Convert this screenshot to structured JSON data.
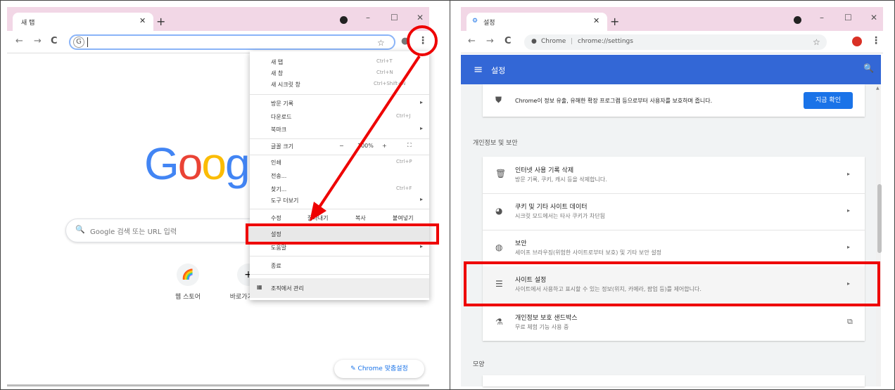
{
  "left": {
    "tab_title": "새 탭",
    "search_placeholder": "Google 검색 또는 URL 입력",
    "shortcuts": [
      "웹 스토어",
      "바로가기 추가"
    ],
    "customize_label": "Chrome 맞춤설정",
    "menu": {
      "new_tab": "새 탭",
      "new_tab_shortcut": "Ctrl+T",
      "new_window": "새 창",
      "new_window_shortcut": "Ctrl+N",
      "incognito": "새 시크릿 창",
      "incognito_shortcut": "Ctrl+Shift+N",
      "history": "방문 기록",
      "downloads": "다운로드",
      "downloads_shortcut": "Ctrl+J",
      "bookmarks": "북마크",
      "zoom": "글꼴 크기",
      "zoom_value": "100%",
      "print": "인쇄",
      "print_shortcut": "Ctrl+P",
      "cast": "전송...",
      "find": "찾기...",
      "find_shortcut": "Ctrl+F",
      "more_tools": "도구 더보기",
      "edit": "수정",
      "cut": "잘라내기",
      "copy": "복사",
      "paste": "붙여넣기",
      "settings": "설정",
      "help": "도움말",
      "exit": "종료",
      "managed": "조직에서 관리"
    }
  },
  "right": {
    "tab_title": "설정",
    "url_prefix": "Chrome",
    "url": "chrome://settings",
    "header_title": "설정",
    "safety_text": "Chrome이 정보 유출, 유해한 확장 프로그램 등으로부터 사용자를 보호하며 줍니다.",
    "safety_button": "지금 확인",
    "privacy_section": "개인정보 및 보안",
    "rows": [
      {
        "title": "인터넷 사용 기록 삭제",
        "sub": "방문 기록, 쿠키, 캐시 등을 삭제합니다."
      },
      {
        "title": "쿠키 및 기타 사이트 데이터",
        "sub": "시크릿 모드에서는 타사 쿠키가 차단됨"
      },
      {
        "title": "보안",
        "sub": "세이프 브라우징(위험한 사이트로부터 보호) 및 기타 보안 설정"
      },
      {
        "title": "사이트 설정",
        "sub": "사이트에서 사용하고 표시할 수 있는 정보(위치, 카메라, 팝업 등)를 제어합니다."
      },
      {
        "title": "개인정보 보호 샌드박스",
        "sub": "무료 체험 기능 사용 중"
      }
    ],
    "appearance_section": "모양"
  }
}
